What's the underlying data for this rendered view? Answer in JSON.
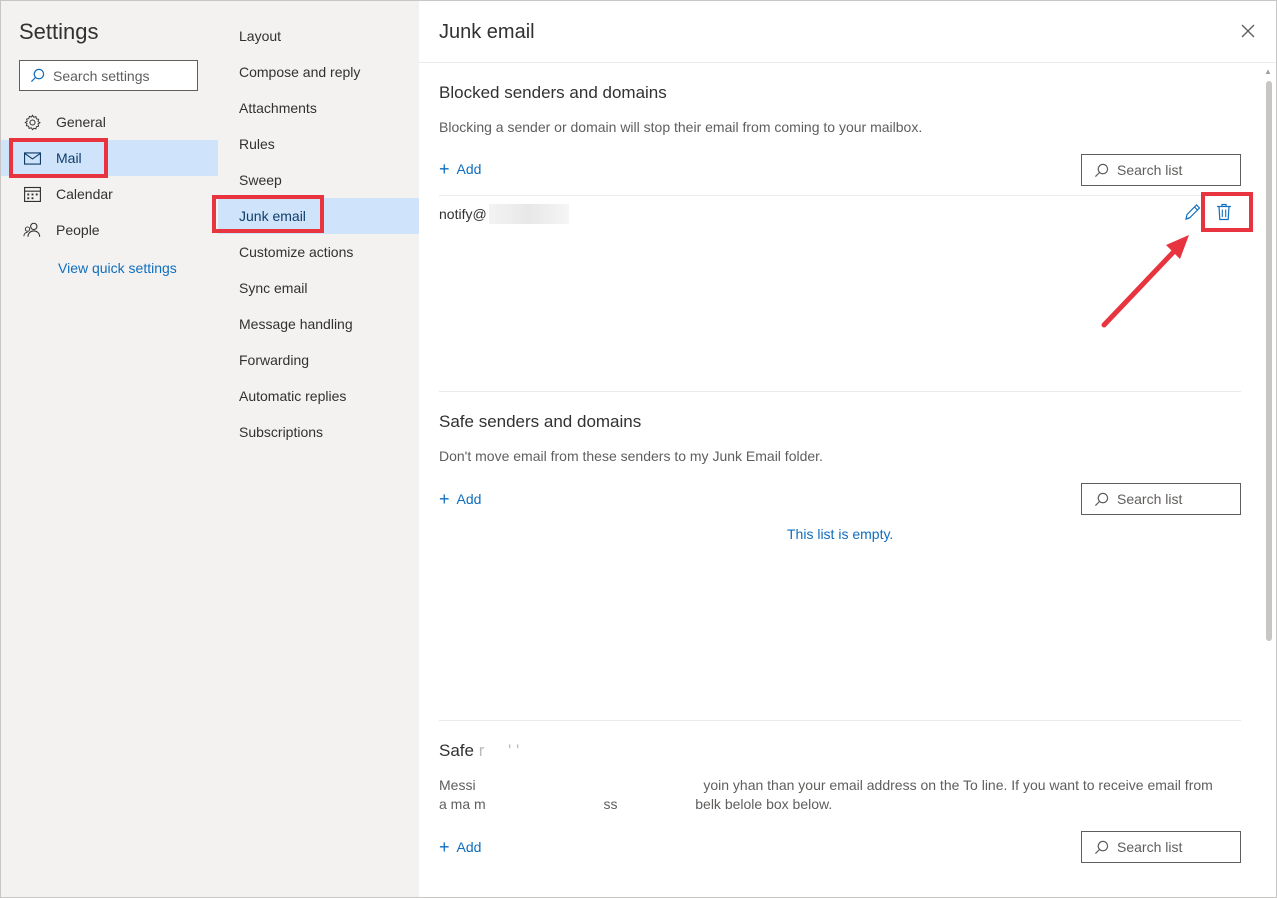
{
  "settings": {
    "title": "Settings",
    "search_placeholder": "Search settings",
    "nav": [
      {
        "label": "General",
        "icon": "gear-icon"
      },
      {
        "label": "Mail",
        "icon": "mail-icon"
      },
      {
        "label": "Calendar",
        "icon": "calendar-icon"
      },
      {
        "label": "People",
        "icon": "people-icon"
      }
    ],
    "quick_settings": "View quick settings"
  },
  "mail_nav": [
    "Layout",
    "Compose and reply",
    "Attachments",
    "Rules",
    "Sweep",
    "Junk email",
    "Customize actions",
    "Sync email",
    "Message handling",
    "Forwarding",
    "Automatic replies",
    "Subscriptions"
  ],
  "panel": {
    "title": "Junk email",
    "blocked": {
      "title": "Blocked senders and domains",
      "desc": "Blocking a sender or domain will stop their email from coming to your mailbox.",
      "add": "Add",
      "search": "Search list",
      "entry": "notify@"
    },
    "safe": {
      "title": "Safe senders and domains",
      "desc": "Don't move email from these senders to my Junk Email folder.",
      "add": "Add",
      "search": "Search list",
      "empty": "This list is empty."
    },
    "mailing": {
      "title": "Safe",
      "desc1_a": "Messi",
      "desc1_b": "yoin yhan than your email address on the To line. If you want to receive email from",
      "desc2_a": "a ma m",
      "desc2_b": "ss",
      "desc2_c": "belk belole box below.",
      "add": "Add",
      "search": "Search list"
    }
  },
  "colors": {
    "accent": "#106ebe",
    "highlight": "#e8343f",
    "selected_bg": "#cfe4fa",
    "nav_bg": "#f3f2f1"
  }
}
